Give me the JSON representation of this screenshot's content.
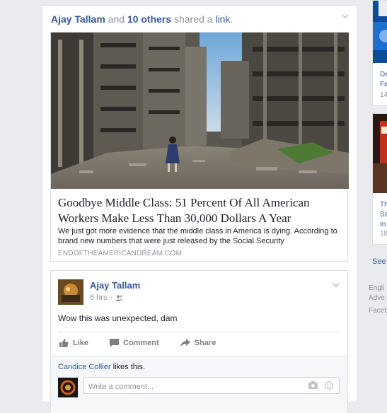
{
  "story": {
    "actor": "Ajay Tallam",
    "conj": " and ",
    "others": "10 others",
    "action": " shared a ",
    "object": "link",
    "period": "."
  },
  "link_preview": {
    "title": "Goodbye Middle Class: 51 Percent Of All American Workers Make Less Than 30,000 Dollars A Year",
    "description": "We just got more evidence that the middle class in America is dying. According to brand new numbers that were just released by the Social Security",
    "domain": "ENDOFTHEAMERICANDREAM.COM"
  },
  "post": {
    "author": "Ajay Tallam",
    "time": "6 hrs",
    "separator": "·",
    "text": "Wow this was unexpected, dam",
    "actions": {
      "like": "Like",
      "comment": "Comment",
      "share": "Share"
    },
    "liker": "Candice Collier",
    "likes_suffix": " likes this.",
    "comment_placeholder": "Write a comment..."
  },
  "sidebar": {
    "ad1_lines": [
      "De",
      "Fe"
    ],
    "ad1_sub": "14",
    "ad2_lines": [
      "Th",
      "Sa",
      "In"
    ],
    "ad2_sub": "18",
    "see_link": "See",
    "footer": [
      "Engli",
      "Adve",
      "Faceb"
    ]
  },
  "colors": {
    "link_blue": "#365899",
    "muted": "#90949c",
    "background": "#e9ebee"
  },
  "icons": [
    "chevron-down-icon",
    "friends-audience-icon",
    "like-thumb-icon",
    "comment-bubble-icon",
    "share-arrow-icon",
    "camera-icon",
    "smiley-icon"
  ]
}
